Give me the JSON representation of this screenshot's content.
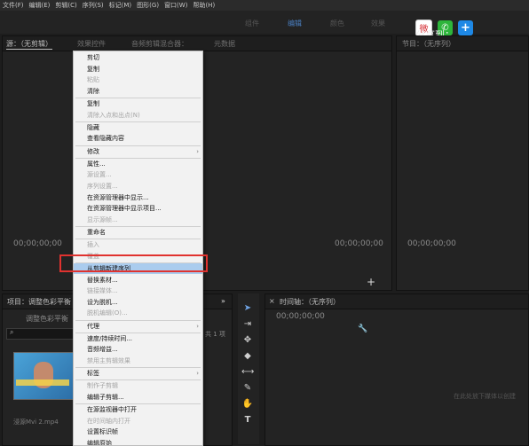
{
  "menubar": [
    "文件(F)",
    "编辑(E)",
    "剪辑(C)",
    "序列(S)",
    "标记(M)",
    "图形(G)",
    "窗口(W)",
    "帮助(H)"
  ],
  "workspaces": [
    "组件",
    "编辑",
    "颜色",
    "效果"
  ],
  "share": {
    "label": "分享到："
  },
  "source_panel": {
    "tabs": [
      "源：（无剪辑）",
      "效果控件",
      "音频剪辑混合器：",
      "元数据"
    ],
    "timecode": "00;00;00;00",
    "timecode_right": "00;00;00;00"
  },
  "program_panel": {
    "tab": "节目：（无序列）",
    "timecode": "00;00;00;00"
  },
  "project_panel": {
    "tab": "项目：调整色彩平衡",
    "filename": "调整色彩平衡",
    "count": "共 1 项",
    "clip": "浸源Mvi 2.mp4"
  },
  "timeline_panel": {
    "tab": "时间轴：（无序列）",
    "timecode": "00;00;00;00",
    "drop_hint": "在此处放下媒体以创建"
  },
  "context_menu": {
    "items": [
      {
        "label": "剪切",
        "enabled": true
      },
      {
        "label": "复制",
        "enabled": true
      },
      {
        "label": "粘贴",
        "enabled": false
      },
      {
        "label": "清除",
        "enabled": true
      },
      {
        "label": "复制",
        "enabled": true
      },
      {
        "label": "清除入点和出点(N)",
        "enabled": false
      },
      {
        "label": "隐藏",
        "enabled": true
      },
      {
        "label": "查看隐藏内容",
        "enabled": true
      },
      {
        "label": "修改",
        "enabled": true,
        "submenu": true
      },
      {
        "label": "属性...",
        "enabled": true
      },
      {
        "label": "源设置...",
        "enabled": false
      },
      {
        "label": "序列设置...",
        "enabled": false
      },
      {
        "label": "在资源管理器中显示...",
        "enabled": true
      },
      {
        "label": "在资源管理器中显示项目...",
        "enabled": true
      },
      {
        "label": "显示源帧...",
        "enabled": false
      },
      {
        "label": "重命名",
        "enabled": true
      },
      {
        "label": "插入",
        "enabled": false
      },
      {
        "label": "覆盖",
        "enabled": false
      },
      {
        "label": "从剪辑新建序列",
        "enabled": true,
        "highlighted": true
      },
      {
        "label": "替换素材...",
        "enabled": true
      },
      {
        "label": "链接媒体...",
        "enabled": false
      },
      {
        "label": "设为脱机...",
        "enabled": true
      },
      {
        "label": "脱机编辑(O)...",
        "enabled": false
      },
      {
        "label": "代理",
        "enabled": true,
        "submenu": true
      },
      {
        "label": "速度/持续时间...",
        "enabled": true
      },
      {
        "label": "音频增益...",
        "enabled": true
      },
      {
        "label": "禁用主剪辑效果",
        "enabled": false
      },
      {
        "label": "标签",
        "enabled": true,
        "submenu": true
      },
      {
        "label": "制作子剪辑",
        "enabled": false
      },
      {
        "label": "编辑子剪辑...",
        "enabled": true
      },
      {
        "label": "在源监视器中打开",
        "enabled": true
      },
      {
        "label": "在时间轴内打开",
        "enabled": false
      },
      {
        "label": "设置标识帧",
        "enabled": true
      },
      {
        "label": "编辑原始",
        "enabled": true
      }
    ]
  }
}
